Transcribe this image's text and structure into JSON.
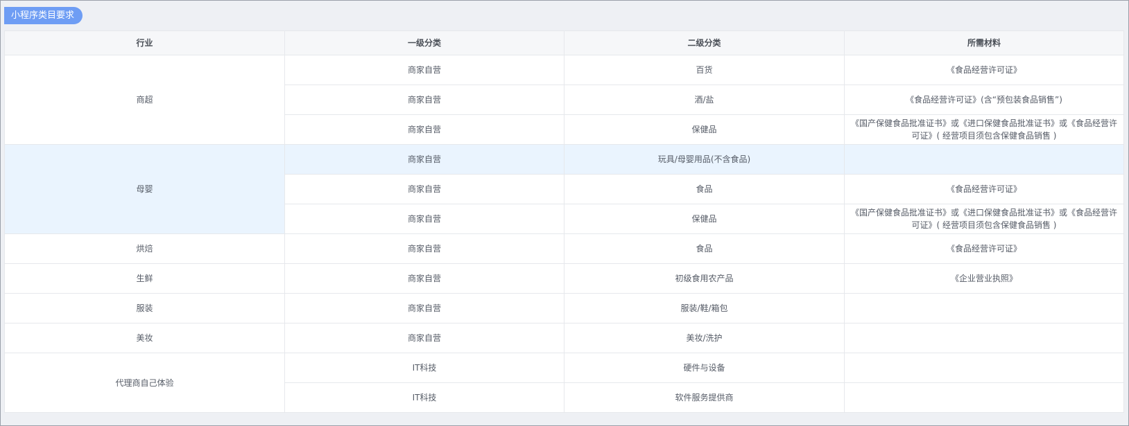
{
  "header": {
    "title": "小程序类目要求"
  },
  "table": {
    "columns": [
      "行业",
      "一级分类",
      "二级分类",
      "所需材料"
    ],
    "groups": [
      {
        "industry": "商超",
        "rows": [
          {
            "level1": "商家自营",
            "level2": "百货",
            "material": "《食品经营许可证》"
          },
          {
            "level1": "商家自营",
            "level2": "酒/盐",
            "material": "《食品经营许可证》(含“预包装食品销售”)"
          },
          {
            "level1": "商家自营",
            "level2": "保健品",
            "material": "《国产保健食品批准证书》或《进口保健食品批准证书》或《食品经营许可证》( 经营项目须包含保健食品销售 )"
          }
        ]
      },
      {
        "industry": "母婴",
        "rows": [
          {
            "level1": "商家自营",
            "level2": "玩具/母婴用品(不含食品)",
            "material": ""
          },
          {
            "level1": "商家自营",
            "level2": "食品",
            "material": "《食品经营许可证》"
          },
          {
            "level1": "商家自营",
            "level2": "保健品",
            "material": "《国产保健食品批准证书》或《进口保健食品批准证书》或《食品经营许可证》( 经营项目须包含保健食品销售 )"
          }
        ]
      },
      {
        "industry": "烘焙",
        "rows": [
          {
            "level1": "商家自营",
            "level2": "食品",
            "material": "《食品经营许可证》"
          }
        ]
      },
      {
        "industry": "生鲜",
        "rows": [
          {
            "level1": "商家自营",
            "level2": "初级食用农产品",
            "material": "《企业营业执照》"
          }
        ]
      },
      {
        "industry": "服装",
        "rows": [
          {
            "level1": "商家自营",
            "level2": "服装/鞋/箱包",
            "material": ""
          }
        ]
      },
      {
        "industry": "美妆",
        "rows": [
          {
            "level1": "商家自营",
            "level2": "美妆/洗护",
            "material": ""
          }
        ]
      },
      {
        "industry": "代理商自己体验",
        "rows": [
          {
            "level1": "IT科技",
            "level2": "硬件与设备",
            "material": ""
          },
          {
            "level1": "IT科技",
            "level2": "软件服务提供商",
            "material": ""
          }
        ]
      }
    ]
  }
}
